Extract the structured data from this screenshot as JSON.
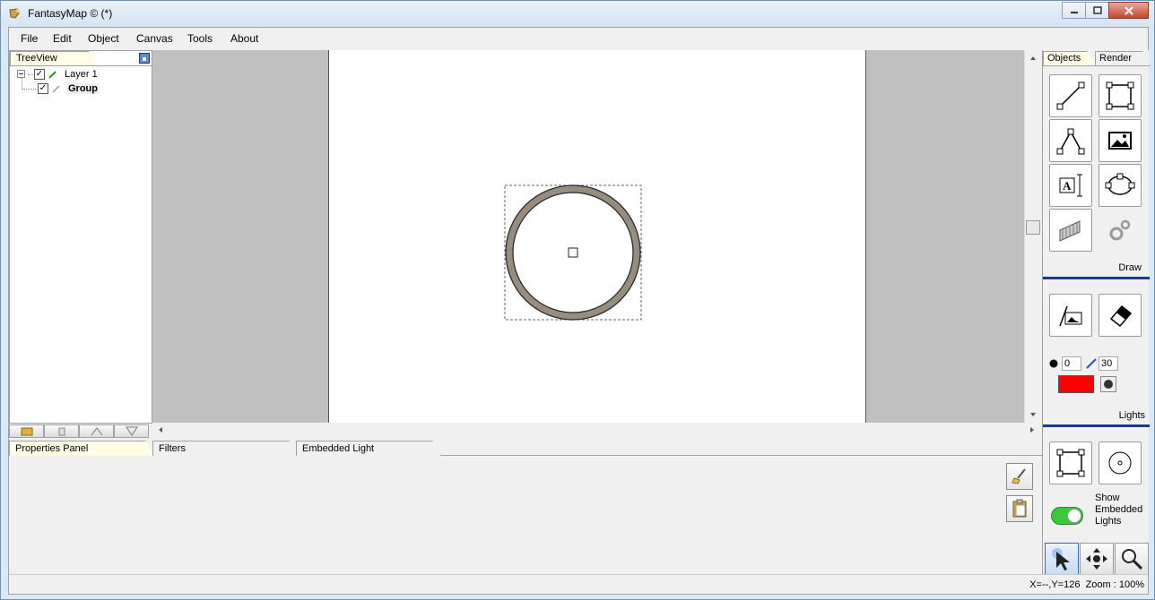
{
  "window": {
    "title": "FantasyMap © (*)"
  },
  "menu": [
    "File",
    "Edit",
    "Object",
    "Canvas",
    "Tools",
    "About"
  ],
  "left_panel": {
    "tab_label": "TreeView",
    "tree": [
      {
        "label": "Layer 1",
        "checked": true,
        "indent": 0
      },
      {
        "label": "Group",
        "checked": true,
        "indent": 1
      }
    ]
  },
  "bottom_tabs": [
    "Properties Panel",
    "Filters",
    "Embedded Light"
  ],
  "right_panel": {
    "tabs": [
      "Objects",
      "Render"
    ],
    "draw_label": "Draw",
    "lights_label": "Lights",
    "light_radius_value": "0",
    "light_size_value": "30",
    "light_color": "#ff0000",
    "show_embedded_lights_label": "Show Embedded Lights",
    "embedded_toggle_color": "#39c939"
  },
  "status": {
    "coords": "X=--,Y=126",
    "zoom": "Zoom : 100%"
  },
  "colors": {
    "ring": "#978c80",
    "accent_blue": "#1c3a8a",
    "toggle_green": "#39c939"
  }
}
